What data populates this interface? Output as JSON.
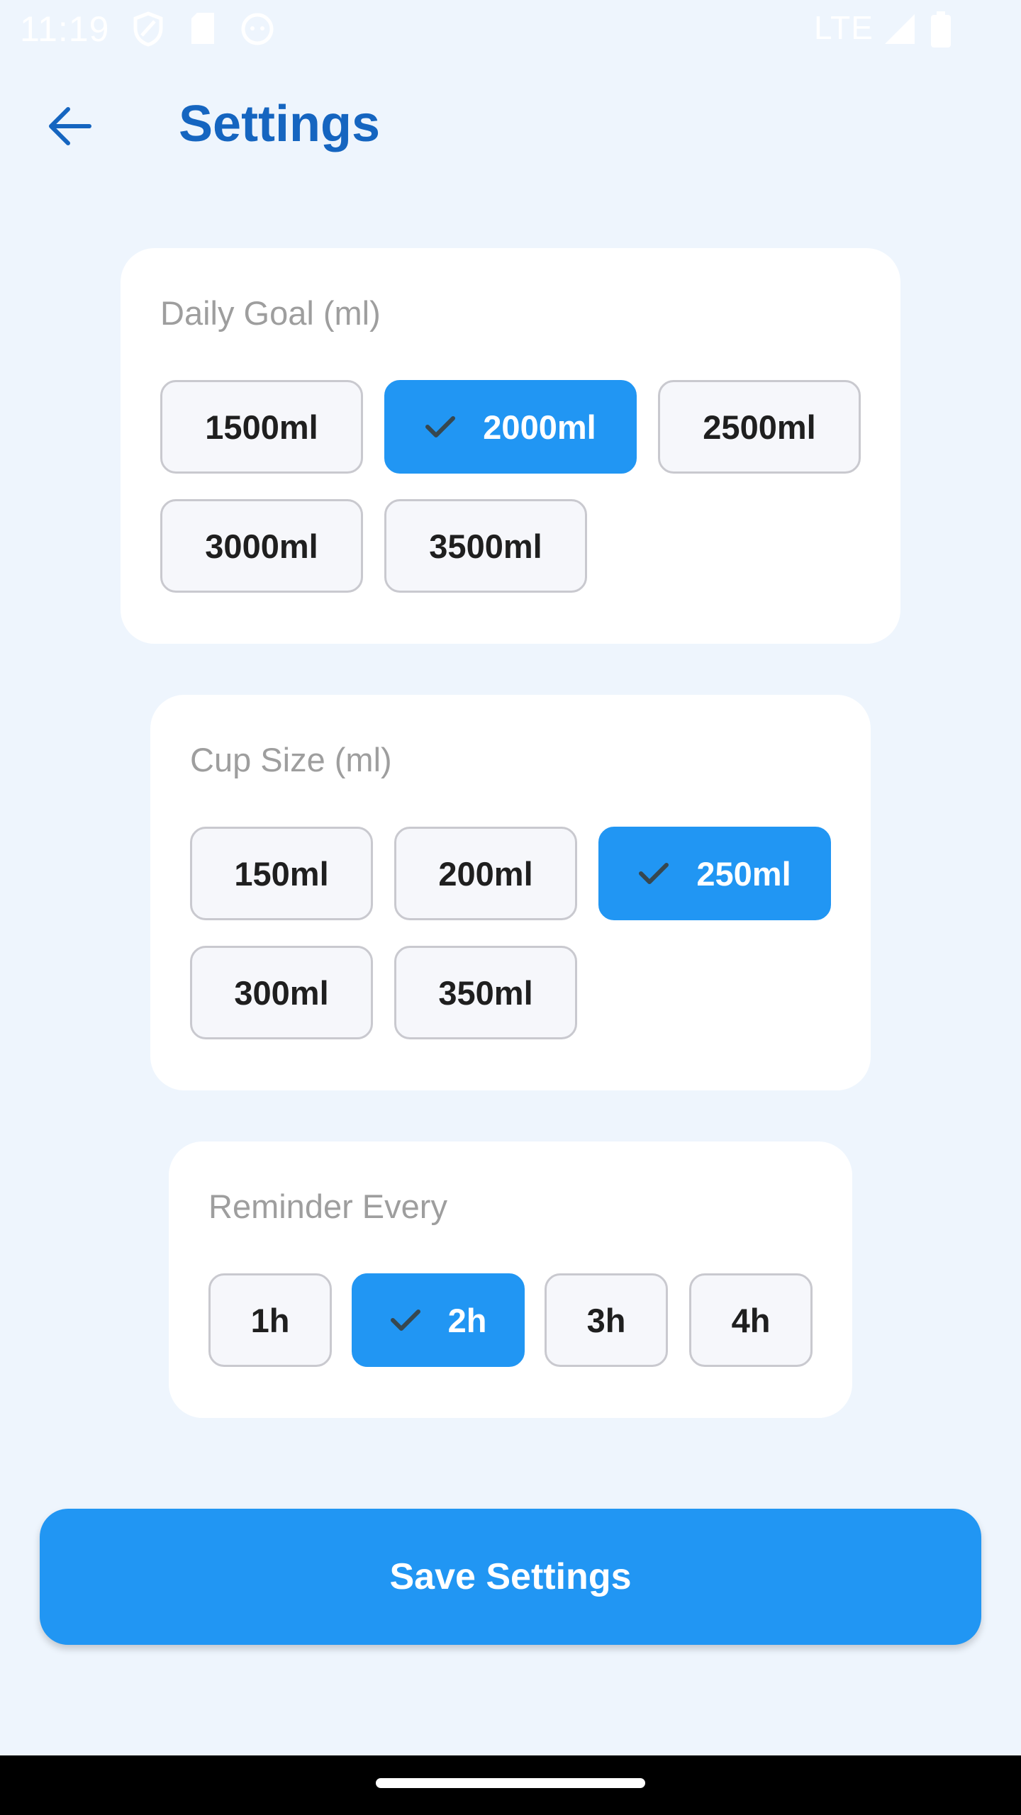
{
  "status_bar": {
    "time": "11:19",
    "network": "LTE"
  },
  "app_bar": {
    "title": "Settings"
  },
  "daily_goal": {
    "label": "Daily Goal (ml)",
    "options": [
      "1500ml",
      "2000ml",
      "2500ml",
      "3000ml",
      "3500ml"
    ],
    "selected": "2000ml"
  },
  "cup_size": {
    "label": "Cup Size (ml)",
    "options": [
      "150ml",
      "200ml",
      "250ml",
      "300ml",
      "350ml"
    ],
    "selected": "250ml"
  },
  "reminder": {
    "label": "Reminder Every",
    "options": [
      "1h",
      "2h",
      "3h",
      "4h"
    ],
    "selected": "2h"
  },
  "save_button": {
    "label": "Save Settings"
  },
  "colors": {
    "accent": "#2196f3",
    "title": "#1565c0",
    "background": "#eef5fd"
  }
}
